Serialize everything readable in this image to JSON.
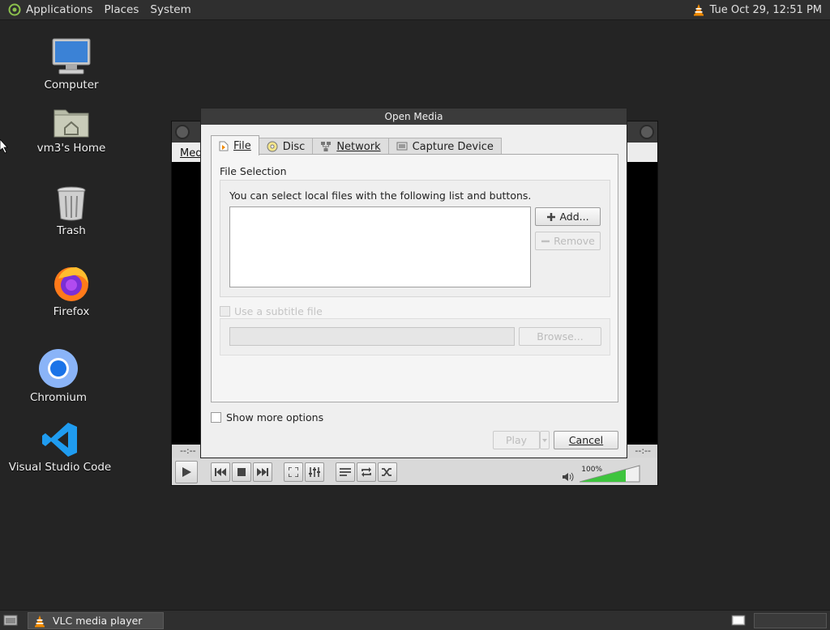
{
  "top_panel": {
    "menu": [
      "Applications",
      "Places",
      "System"
    ],
    "clock": "Tue Oct 29, 12:51 PM"
  },
  "desktop_icons": [
    {
      "label": "Computer",
      "icon": "monitor-icon"
    },
    {
      "label": "vm3's Home",
      "icon": "home-folder-icon"
    },
    {
      "label": "Trash",
      "icon": "trash-icon"
    },
    {
      "label": "Firefox",
      "icon": "firefox-icon"
    },
    {
      "label": "Chromium",
      "icon": "chromium-icon"
    },
    {
      "label": "Visual Studio Code",
      "icon": "vscode-icon"
    }
  ],
  "vlc": {
    "menu_partial": "Med",
    "time_left": "--:--",
    "time_right": "--:--",
    "volume": "100%"
  },
  "dialog": {
    "title": "Open Media",
    "tabs": [
      {
        "label": "File",
        "icon": "file-icon",
        "active": true
      },
      {
        "label": "Disc",
        "icon": "disc-icon",
        "active": false
      },
      {
        "label": "Network",
        "icon": "network-icon",
        "active": false
      },
      {
        "label": "Capture Device",
        "icon": "capture-device-icon",
        "active": false
      }
    ],
    "file_selection_title": "File Selection",
    "hint": "You can select local files with the following list and buttons.",
    "add_label": "Add...",
    "remove_label": "Remove",
    "subtitle_label": "Use a subtitle file",
    "browse_label": "Browse...",
    "show_more_label": "Show more options",
    "play_label": "Play",
    "cancel_label": "Cancel"
  },
  "taskbar": {
    "task_label": "VLC media player"
  },
  "colors": {
    "desktop_bg": "#242424",
    "panel_bg": "#2f2f2f",
    "vlc_orange": "#f08a00",
    "volume_green": "#3ec43e"
  }
}
